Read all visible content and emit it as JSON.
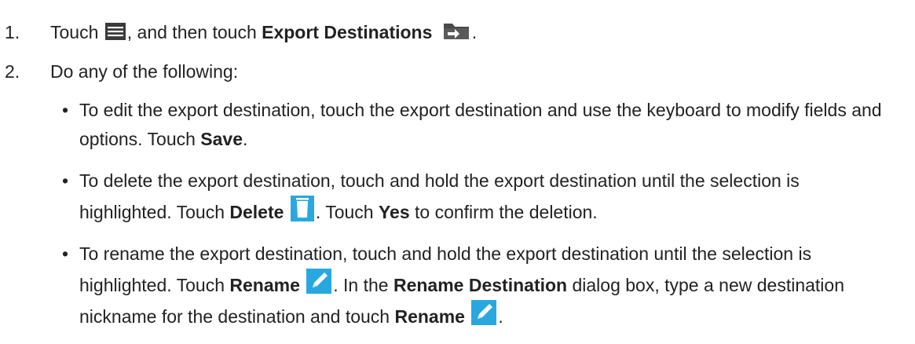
{
  "steps": [
    {
      "number": "1.",
      "text_touch": "Touch",
      "text_then": ", and then touch",
      "bold_export": "Export Destinations",
      "text_end": "."
    },
    {
      "number": "2.",
      "text": "Do any of the following:"
    }
  ],
  "bullets": {
    "marker": "•",
    "edit": {
      "text_a": "To edit the export destination, touch the export destination and use the keyboard to modify fields and options. Touch",
      "bold_save": "Save",
      "text_end": "."
    },
    "delete": {
      "text_a": "To delete the export destination, touch and hold the export destination until the selection is highlighted. Touch",
      "bold_delete": "Delete",
      "text_b": ". Touch",
      "bold_yes": "Yes",
      "text_c": "to confirm the deletion."
    },
    "rename": {
      "text_a": "To rename the export destination, touch and hold the export destination until the selection is highlighted. Touch",
      "bold_rename": "Rename",
      "text_b": ". In the",
      "bold_dialog": "Rename Destination",
      "text_c": "dialog box, type a new destination nickname for the destination and touch",
      "bold_rename2": "Rename",
      "text_end": "."
    }
  },
  "icons": {
    "menu": "menu-icon",
    "export": "export-destinations-icon",
    "delete": "trash-icon",
    "rename": "pencil-icon"
  },
  "colors": {
    "text": "#222222",
    "menu_icon": "#3a3a3a",
    "trash_icon": "#29a8e0",
    "pencil_icon": "#29a8e0",
    "export_icon": "#4a4a4a"
  }
}
